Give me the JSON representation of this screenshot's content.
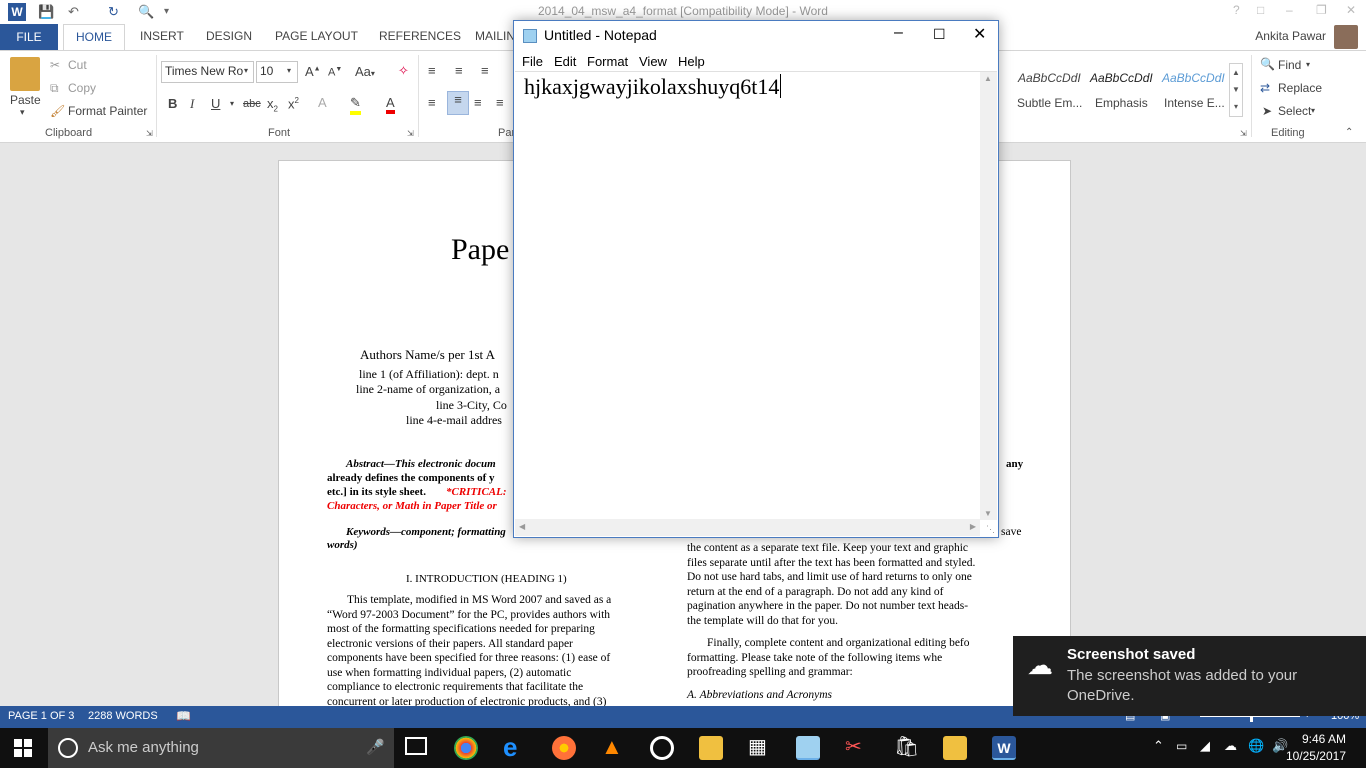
{
  "word": {
    "title": "2014_04_msw_a4_format [Compatibility Mode] - Word",
    "user": "Ankita Pawar",
    "tabs": [
      "FILE",
      "HOME",
      "INSERT",
      "DESIGN",
      "PAGE LAYOUT",
      "REFERENCES",
      "MAILIN"
    ],
    "clipboard": {
      "paste": "Paste",
      "cut": "Cut",
      "copy": "Copy",
      "format_painter": "Format Painter",
      "group": "Clipboard"
    },
    "font": {
      "name": "Times New Ro",
      "size": "10",
      "group": "Font"
    },
    "paragraph_group": "Par",
    "styles": [
      {
        "sample": "AaBbCcDdI",
        "name": "Subtle Em..."
      },
      {
        "sample": "AaBbCcDdI",
        "name": "Emphasis"
      },
      {
        "sample": "AaBbCcDdI",
        "name": "Intense E..."
      }
    ],
    "editing": {
      "find": "Find",
      "replace": "Replace",
      "select": "Select",
      "group": "Editing"
    },
    "status": {
      "page": "PAGE 1 OF 3",
      "words": "2288 WORDS",
      "zoom": "100%"
    }
  },
  "document": {
    "title": "Pape",
    "author_line": "Authors Name/s per 1st A",
    "affil_1": "line 1 (of Affiliation): dept. n",
    "affil_2": "line 2-name of organization, a",
    "affil_3": "line 3-City, Co",
    "affil_4": "line 4-e-mail addres",
    "abstract_1": "Abstract—This electronic docum",
    "abstract_2": "already defines the components of y",
    "abstract_3a": "etc.] in its style sheet.",
    "abstract_3b": "*CRITICAL:",
    "abstract_4": "Characters, or Math in Paper Title or",
    "abstract_right": "any",
    "keywords_1": "Keywords—component; formatting",
    "keywords_2": "words)",
    "heading_1": "I.   INTRODUCTION (HEADING 1)",
    "left_col": [
      "This template, modified in MS Word 2007 and saved as  a",
      "“Word 97-2003 Document” for the PC, provides authors with",
      "most of the formatting specifications needed for preparing",
      "electronic  versions  of  their  papers.  All  standard  paper",
      "components have been specified for three reasons: (1) ease of",
      "use  when  formatting  individual  papers,  (2)  automatic",
      "compliance  to  electronic  requirements  that  facilitate  the",
      "concurrent or later production of electronic products, and (3)"
    ],
    "right_col": [
      "save",
      "the content as a separate text file. Keep your text and graphic",
      "files separate until after the text has been formatted and styled.",
      "Do not use hard tabs, and limit use of hard returns to only one",
      "return at the end of a paragraph. Do not add any kind of",
      "pagination anywhere in the paper. Do not number text heads-",
      "the template will do that for you."
    ],
    "right_col2": [
      "Finally, complete content and organizational editing befo",
      "formatting. Please take note of the following items whe",
      "proofreading spelling and grammar:"
    ],
    "subheading": "A.   Abbreviations and Acronyms"
  },
  "notepad": {
    "title": "Untitled - Notepad",
    "menu": [
      "File",
      "Edit",
      "Format",
      "View",
      "Help"
    ],
    "content": "hjkaxjgwayjikolaxshuyq6t14"
  },
  "toast": {
    "title": "Screenshot saved",
    "body": "The screenshot was added to your OneDrive."
  },
  "taskbar": {
    "search_placeholder": "Ask me anything",
    "time": "9:46 AM",
    "date": "10/25/2017"
  }
}
